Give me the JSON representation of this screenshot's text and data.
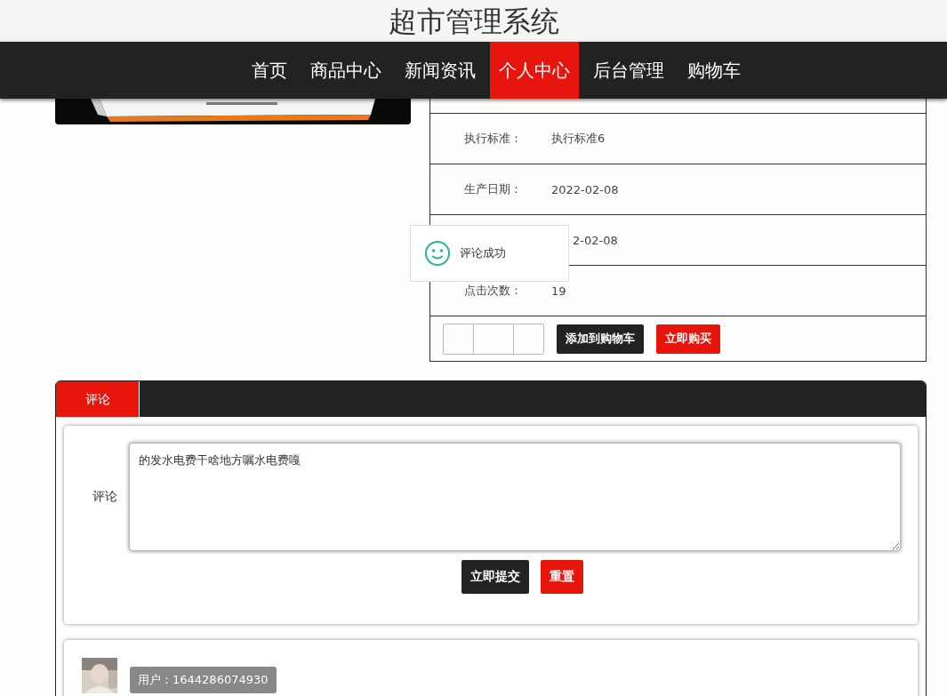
{
  "header": {
    "title": "超市管理系统"
  },
  "nav": [
    {
      "label": "首页",
      "selected": false
    },
    {
      "label": "商品中心",
      "selected": false
    },
    {
      "label": "新闻资讯",
      "selected": false
    },
    {
      "label": "个人中心",
      "selected": true
    },
    {
      "label": "后台管理",
      "selected": false
    },
    {
      "label": "购物车",
      "selected": false
    }
  ],
  "details": [
    {
      "label": "执行标准：",
      "value": "执行标准6"
    },
    {
      "label": "生产日期：",
      "value": "2022-02-08"
    },
    {
      "value": "2-02-08"
    },
    {
      "label": "点击次数：",
      "value": "19"
    }
  ],
  "actions": [
    {
      "label": "添加到购物车",
      "kind": "dark"
    },
    {
      "label": "立即购买",
      "kind": "red"
    }
  ],
  "toast": {
    "message": "评论成功"
  },
  "comments": {
    "tabs": [
      {
        "label": "评论",
        "selected": true
      }
    ],
    "form": {
      "label": "评论",
      "value": "的发水电费干啥地方嘱水电费嘎",
      "buttons": [
        {
          "label": "立即提交",
          "kind": "dark"
        },
        {
          "label": "重置",
          "kind": "red"
        }
      ]
    },
    "entries": [
      {
        "user": "用户：1644286074930"
      }
    ]
  }
}
